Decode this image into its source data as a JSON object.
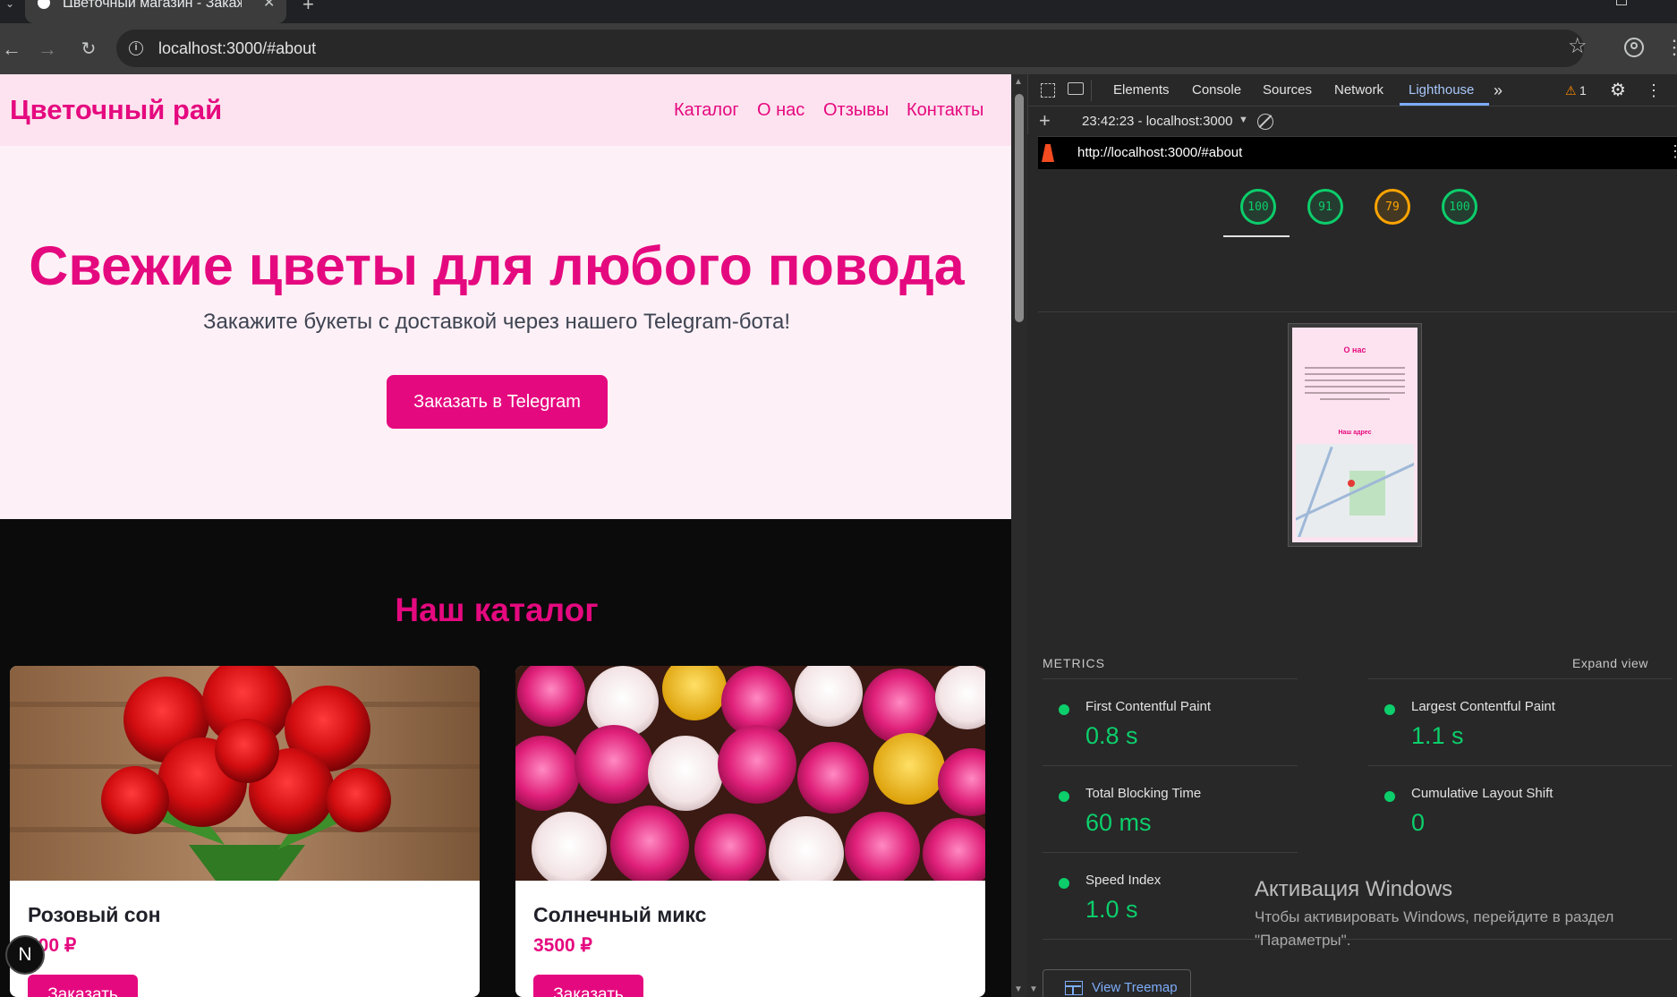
{
  "browser": {
    "tab_title": "Цветочный магазин - Закаж",
    "url": "localhost:3000/#about"
  },
  "site": {
    "brand": "Цветочный рай",
    "nav": [
      "Каталог",
      "О нас",
      "Отзывы",
      "Контакты"
    ],
    "hero": {
      "title": "Свежие цветы для любого повода",
      "subtitle": "Закажите букеты с доставкой через нашего Telegram-бота!",
      "cta": "Заказать в Telegram"
    },
    "catalog_title": "Наш каталог",
    "products": [
      {
        "name": "Розовый сон",
        "price": "500 ₽",
        "button": "Заказать"
      },
      {
        "name": "Солнечный микс",
        "price": "3500 ₽",
        "button": "Заказать"
      }
    ],
    "badge": "N"
  },
  "devtools": {
    "tabs": [
      "Elements",
      "Console",
      "Sources",
      "Network",
      "Lighthouse"
    ],
    "active_tab": "Lighthouse",
    "warning_count": "1",
    "report_time": "23:42:23 - localhost:3000",
    "report_url": "http://localhost:3000/#about",
    "scores": [
      "100",
      "91",
      "79",
      "100"
    ],
    "score_colors": [
      "#0cce6b",
      "#0cce6b",
      "#ffa400",
      "#0cce6b"
    ],
    "metrics_heading": "METRICS",
    "expand_label": "Expand view",
    "metrics": [
      {
        "label": "First Contentful Paint",
        "value": "0.8 s"
      },
      {
        "label": "Largest Contentful Paint",
        "value": "1.1 s"
      },
      {
        "label": "Total Blocking Time",
        "value": "60 ms"
      },
      {
        "label": "Cumulative Layout Shift",
        "value": "0"
      },
      {
        "label": "Speed Index",
        "value": "1.0 s"
      }
    ],
    "treemap_label": "View Treemap",
    "thumbnail": {
      "title": "О нас",
      "address_heading": "Наш адрес"
    }
  },
  "windows_activation": {
    "title": "Активация Windows",
    "text": "Чтобы активировать Windows, перейдите в раздел \"Параметры\"."
  },
  "colors": {
    "brand": "#e5097f",
    "pass": "#0cce6b",
    "average": "#ffa400",
    "link": "#7cacf8"
  }
}
